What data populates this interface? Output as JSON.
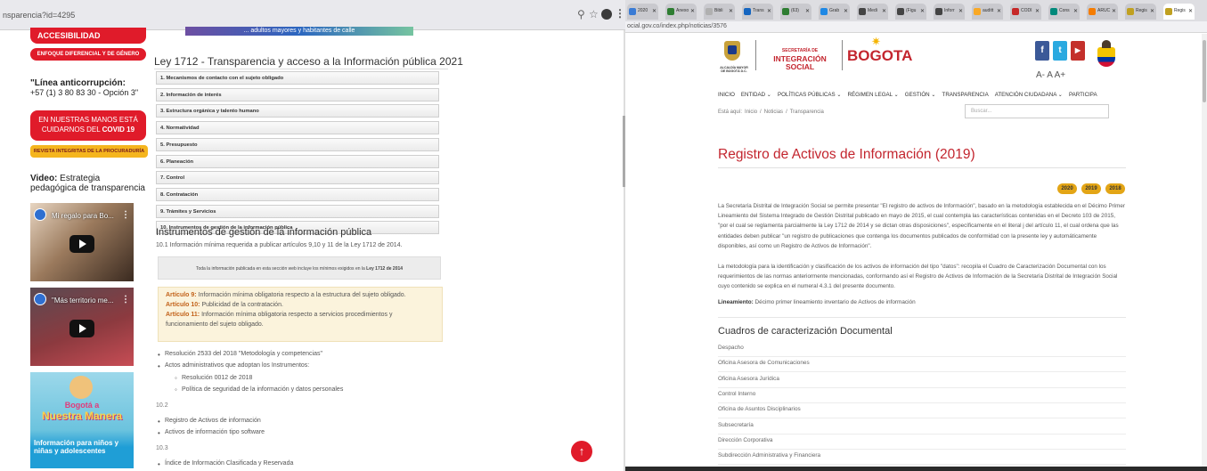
{
  "left": {
    "url": "nsparencia?id=4295",
    "browser_icons": [
      "zoom-icon",
      "star-icon"
    ],
    "sidebar": {
      "accesibilidad": "ACCESIBILIDAD",
      "enfoque": "ENFOQUE DIFERENCIAL Y DE GÉNERO",
      "anticorrupcion_title": "\"Línea anticorrupción:",
      "anticorrupcion_phone": "+57 (1) 3 80 83 30 - Opción 3\"",
      "covid_line1": "EN NUESTRAS MANOS ESTÁ",
      "covid_line2_prefix": "CUIDARNOS DEL ",
      "covid_line2_bold": "COVID 19",
      "revista": "REVISTA INTEGRITAS DE LA PROCURADURÍA",
      "video_bold": "Video:",
      "video_text": " Estrategia pedagógica de transparencia",
      "video1_title": "Mi regalo para Bo...",
      "video2_title": "\"Más territorio me...",
      "promo_t1": "Bogotá a",
      "promo_t2": "Nuestra Manera",
      "promo_t3": "Información para niños y niñas y adolescentes"
    },
    "banner": "... adultos mayores y habitantes de calle",
    "title": "Ley 1712 - Transparencia y acceso a la Información pública 2021",
    "accordion": [
      "1. Mecanismos de contacto con el sujeto obligado",
      "2. Información de interés",
      "3. Estructura orgánica y talento humano",
      "4. Normatividad",
      "5. Presupuesto",
      "6. Planeación",
      "7. Control",
      "8. Contratación",
      "9. Trámites y Servicios",
      "10. Instrumentos de gestión de la información pública"
    ],
    "section_heading": "Instrumentos de gestión de la información pública",
    "section_sub": "10.1 Información mínima requerida a publicar artículos 9,10 y 11 de la Ley 1712 de 2014.",
    "gray_note_prefix": "Toda la información publicada en esta sección web incluye los mínimos exigidos en la ",
    "gray_note_bold": "Ley 1712 de 2014",
    "articles": [
      {
        "label": "Artículo 9:",
        "text": " Información mínima obligatoria respecto a la estructura del sujeto obligado."
      },
      {
        "label": "Artículo 10:",
        "text": " Publicidad de la contratación."
      },
      {
        "label": "Artículo 11:",
        "text": " Información mínima obligatoria respecto a servicios procedimientos y funcionamiento del sujeto obligado."
      }
    ],
    "list_101": [
      "Resolución 2533 del 2018 \"Metodología y competencias\"",
      "Actos administrativos que adoptan los Instrumentos:"
    ],
    "list_101_sub": [
      "Resolución 0012 de 2018",
      "Política de seguridad de la información y datos personales"
    ],
    "num_102": "10.2",
    "list_102": [
      "Registro de Activos de información",
      "Activos de información tipo software"
    ],
    "num_103": "10.3",
    "list_103": [
      "Índice de Información Clasificada y Reservada"
    ],
    "scroll_top_icon": "arrow-up-icon"
  },
  "right": {
    "tabs": [
      "2020",
      "Anexo",
      "Bibli",
      "Trans",
      "(63)",
      "Grab",
      "Medi",
      "(Figu",
      "Inforr",
      "auditt",
      "CODI",
      "Cons",
      "ARUC",
      "Regis",
      "Regis"
    ],
    "url": "ocial.gov.co/index.php/noticias/3576",
    "logo": {
      "alcaldia": "ALCALDÍA MAYOR DE BOGOTÁ D.C.",
      "secretaria_small": "SECRETARÍA DE",
      "secretaria_big": "INTEGRACIÓN SOCIAL",
      "bogota": "BOGOTA"
    },
    "social": {
      "facebook": "f",
      "twitter": "t",
      "youtube": "▶"
    },
    "font_sizes": "A- A A+",
    "nav": [
      "INICIO",
      "ENTIDAD ⌄",
      "POLÍTICAS PÚBLICAS ⌄",
      "RÉGIMEN LEGAL ⌄",
      "GESTIÓN ⌄",
      "TRANSPARENCIA",
      "ATENCIÓN CIUDADANA ⌄",
      "PARTICIPA"
    ],
    "breadcrumb": [
      "Está aquí:",
      "Inicio",
      "/",
      "Noticias",
      "/",
      "Transparencia"
    ],
    "search_placeholder": "Buscar...",
    "heading": "Registro de Activos de Información (2019)",
    "years": [
      "2020",
      "2019",
      "2018"
    ],
    "para1": "La Secretaría Distrital de Integración Social se permite presentar \"El registro de activos de Información\", basado en la metodología establecida en el Décimo Primer Lineamiento del Sistema Integrado de Gestión Distrital publicado en mayo de 2015, el cual contempla las características contenidas en el Decreto 103 de 2015, \"por el cual se reglamenta parcialmente la Ley 1712 de 2014 y se dictan otras disposiciones\", específicamente en el literal j del artículo 11, el cual ordena que las entidades deben publicar \"un registro de publicaciones que contenga los documentos publicados de conformidad con la presente ley y automáticamente disponibles, así como un Registro de Activos de Información\".",
    "para2": "La metodología para la identificación y clasificación de los activos de información del tipo \"datos\": recopila el Cuadro de Caracterización Documental con los requerimientos de las normas anteriormente mencionadas, conformando así el Registro de Activos de Información de la Secretaría Distrital de Integración Social cuyo contenido se explica en el numeral 4.3.1 del presente documento.",
    "lineamiento_bold": "Lineamiento:",
    "lineamiento_text": " Décimo primer lineamiento inventario de Activos de información",
    "cuadros_heading": "Cuadros de caracterización Documental",
    "cuadros": [
      "Despacho",
      "Oficina Asesora de Comunicaciones",
      "Oficina Asesora Jurídica",
      "Control Interno",
      "Oficina de Asuntos Disciplinarios",
      "Subsecretaría",
      "Dirección Corporativa",
      "Subdirección Administrativa y Financiera"
    ]
  },
  "colors": {
    "brand_red": "#c3252e",
    "button_red": "#e01b2a",
    "year_gold": "#e3a516",
    "revista_yellow": "#f5b51e"
  }
}
